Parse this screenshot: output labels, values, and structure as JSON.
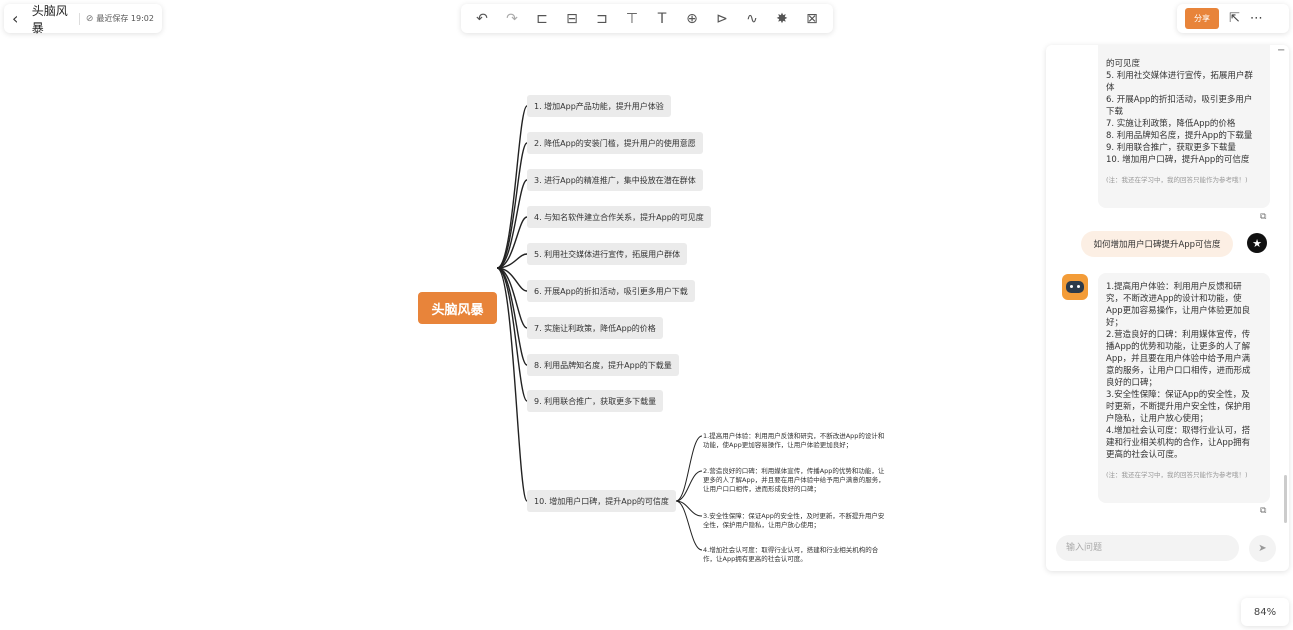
{
  "header": {
    "back_icon": "chevron-left-icon",
    "title": "头脑风暴",
    "save_status": "最近保存 19:02"
  },
  "toolbar": {
    "tools": [
      {
        "name": "undo-icon",
        "glyph": "↶"
      },
      {
        "name": "redo-icon",
        "glyph": "↷"
      },
      {
        "name": "insert-sibling-icon",
        "glyph": "⊏"
      },
      {
        "name": "insert-child-icon",
        "glyph": "⊟"
      },
      {
        "name": "insert-parent-icon",
        "glyph": "⊐"
      },
      {
        "name": "format-painter-icon",
        "glyph": "⊤"
      },
      {
        "name": "text-icon",
        "glyph": "T"
      },
      {
        "name": "add-icon",
        "glyph": "⊕"
      },
      {
        "name": "summary-icon",
        "glyph": "⊳"
      },
      {
        "name": "link-icon",
        "glyph": "∿"
      },
      {
        "name": "ai-icon",
        "glyph": "✸"
      },
      {
        "name": "present-icon",
        "glyph": "⊠"
      }
    ]
  },
  "top_right": {
    "share_label": "分享",
    "open_icon": "external-link-icon",
    "more_icon": "more-icon"
  },
  "mindmap": {
    "root": "头脑风暴",
    "branches": [
      "1. 增加App产品功能，提升用户体验",
      "2. 降低App的安装门槛，提升用户的使用意愿",
      "3. 进行App的精准推广，集中投放在潜在群体",
      "4. 与知名软件建立合作关系，提升App的可见度",
      "5. 利用社交媒体进行宣传，拓展用户群体",
      "6. 开展App的折扣活动，吸引更多用户下载",
      "7. 实施让利政策，降低App的价格",
      "8. 利用品牌知名度，提升App的下载量",
      "9. 利用联合推广，获取更多下载量",
      "10. 增加用户口碑，提升App的可信度"
    ],
    "leaves": [
      [
        "1.提高用户体验：利用用户反馈和研究，不断改进App的设计和",
        "功能，使App更加容易操作，让用户体验更加良好；"
      ],
      [
        "2.营造良好的口碑：利用媒体宣传，传播App的优势和功能，让",
        "更多的人了解App，并且要在用户体验中给予用户满意的服务，",
        "让用户口口相传，进而形成良好的口碑；"
      ],
      [
        "3.安全性保障：保证App的安全性，及时更新，不断提升用户安",
        "全性，保护用户隐私，让用户放心使用；"
      ],
      [
        "4.增加社会认可度：取得行业认可，搭建和行业相关机构的合",
        "作，让App拥有更高的社会认可度。"
      ]
    ]
  },
  "chat": {
    "collapse_icon": "minus-icon",
    "prev_answer_lines": [
      "的可见度",
      "5. 利用社交媒体进行宣传，拓展用户群",
      "体",
      "6. 开展App的折扣活动，吸引更多用户",
      "下载",
      "7. 实施让利政策，降低App的价格",
      "8. 利用品牌知名度，提升App的下载量",
      "9. 利用联合推广，获取更多下载量",
      "10. 增加用户口碑，提升App的可信度"
    ],
    "note": "(注：我还在学习中，我的回答只能作为参考哦！)",
    "user_question": "如何增加用户口碑提升App可信度",
    "answer_lines": [
      "1.提高用户体验：利用用户反馈和研",
      "究，不断改进App的设计和功能，使",
      "App更加容易操作，让用户体验更加良",
      "好；",
      "2.营造良好的口碑：利用媒体宣传，传",
      "播App的优势和功能，让更多的人了解",
      "App，并且要在用户体验中给予用户满",
      "意的服务，让用户口口相传，进而形成",
      "良好的口碑；",
      "3.安全性保障：保证App的安全性，及",
      "时更新，不断提升用户安全性，保护用",
      "户隐私，让用户放心使用；",
      "4.增加社会认可度：取得行业认可，搭",
      "建和行业相关机构的合作，让App拥有",
      "更高的社会认可度。"
    ],
    "input_placeholder": "输入问题",
    "send_icon": "send-icon"
  },
  "zoom_level": "84%",
  "colors": {
    "accent": "#e8843a",
    "node_bg": "#ebebeb",
    "line": "#222222"
  }
}
